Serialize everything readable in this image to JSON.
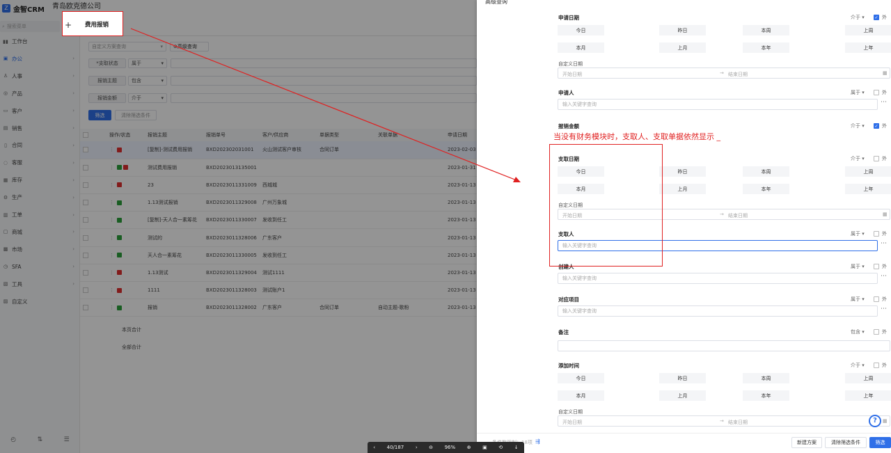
{
  "app": {
    "logo": "金智CRM",
    "company": "青岛欧克德公司"
  },
  "sidebar": {
    "search_placeholder": "搜索菜单",
    "items": [
      {
        "label": "工作台",
        "icon": "▮▮"
      },
      {
        "label": "办公",
        "icon": "▣"
      },
      {
        "label": "人事",
        "icon": "♙"
      },
      {
        "label": "产品",
        "icon": "◎"
      },
      {
        "label": "客户",
        "icon": "▭"
      },
      {
        "label": "销售",
        "icon": "▤"
      },
      {
        "label": "合同",
        "icon": "▯"
      },
      {
        "label": "客服",
        "icon": "◌"
      },
      {
        "label": "库存",
        "icon": "▦"
      },
      {
        "label": "生产",
        "icon": "⚙"
      },
      {
        "label": "工单",
        "icon": "▥"
      },
      {
        "label": "商城",
        "icon": "▢"
      },
      {
        "label": "市场",
        "icon": "▩"
      },
      {
        "label": "SFA",
        "icon": "◷"
      },
      {
        "label": "工具",
        "icon": "▧"
      },
      {
        "label": "自定义",
        "icon": "▨"
      }
    ],
    "bottom_icons": [
      "◴",
      "⇅",
      "☰"
    ]
  },
  "tab": {
    "plus": "+",
    "title": "费用报销"
  },
  "filters": {
    "scheme_placeholder": "自定义方案查询",
    "advanced_button": "高级查询",
    "rows": [
      {
        "field": "*支取状态",
        "op": "属于"
      },
      {
        "field": "报销主题",
        "op": "包含"
      },
      {
        "field": "报销金额",
        "op": "介于"
      }
    ],
    "filter_button": "筛选",
    "clear_button": "清除筛选条件"
  },
  "table": {
    "headers": [
      "操作/状态",
      "报销主题",
      "报销单号",
      "客户/供应商",
      "单据类型",
      "关联单据",
      "申请日期"
    ],
    "rows": [
      {
        "status": "r",
        "subject": "[复制]-测试费用报销",
        "no": "BXD202302031001",
        "customer": "火山测试客户审核",
        "type": "合同订单",
        "related": "",
        "date": "2023-02-03"
      },
      {
        "status": "gr",
        "subject": "测试费用报销",
        "no": "BXD2023013135001",
        "customer": "",
        "type": "",
        "related": "",
        "date": "2023-01-31"
      },
      {
        "status": "r",
        "subject": "23",
        "no": "BXD2023011331009",
        "customer": "西城城",
        "type": "",
        "related": "",
        "date": "2023-01-13"
      },
      {
        "status": "g",
        "subject": "1.13测试报销",
        "no": "BXD2023011329008",
        "customer": "广州万象城",
        "type": "",
        "related": "",
        "date": "2023-01-13"
      },
      {
        "status": "g",
        "subject": "[复制]-天人合一素筹花",
        "no": "BXD2023011330007",
        "customer": "发收到任工",
        "type": "",
        "related": "",
        "date": "2023-01-13"
      },
      {
        "status": "g",
        "subject": "测试的",
        "no": "BXD2023011328006",
        "customer": "广东客户",
        "type": "",
        "related": "",
        "date": "2023-01-13"
      },
      {
        "status": "g",
        "subject": "天人合一素筹花",
        "no": "BXD2023011330005",
        "customer": "发收到任工",
        "type": "",
        "related": "",
        "date": "2023-01-13"
      },
      {
        "status": "r",
        "subject": "1.13测试",
        "no": "BXD2023011329004",
        "customer": "测试1111",
        "type": "",
        "related": "",
        "date": "2023-01-13"
      },
      {
        "status": "r",
        "subject": "1111",
        "no": "BXD2023011328003",
        "customer": "测试账户1",
        "type": "",
        "related": "",
        "date": "2023-01-13"
      },
      {
        "status": "g",
        "subject": "报销",
        "no": "BXD2023011328002",
        "customer": "广东客户",
        "type": "合同订单",
        "related": "自动主题-歌粉",
        "date": "2023-01-13"
      }
    ],
    "page_total": "本页合计",
    "all_total": "全部合计"
  },
  "panel": {
    "title": "高级查询",
    "date_buttons": [
      "今日",
      "昨日",
      "本周",
      "上周",
      "本月",
      "上月",
      "本年",
      "上年"
    ],
    "custom_date": "自定义日期",
    "start_placeholder": "开始日期",
    "end_placeholder": "结束日期",
    "arrow": "→",
    "external": "外",
    "keyword_placeholder": "输入关键字查询",
    "sections": {
      "apply_date": {
        "label": "申请日期",
        "op": "介于"
      },
      "applicant": {
        "label": "申请人",
        "op": "属于"
      },
      "amount": {
        "label": "报销金额",
        "op": "介于"
      },
      "pay_date": {
        "label": "支取日期",
        "op": "介于"
      },
      "payer": {
        "label": "支取人",
        "op": "属于"
      },
      "creator": {
        "label": "创建人",
        "op": "属于"
      },
      "project": {
        "label": "对应项目",
        "op": "属于"
      },
      "remark": {
        "label": "备注",
        "op": "包含"
      },
      "add_time": {
        "label": "添加时间",
        "op": "介于"
      }
    },
    "footer": {
      "count": "条件数限制：18项",
      "new_scheme": "新建方案",
      "clear": "清除筛选条件",
      "filter": "筛选"
    }
  },
  "annotation": "当没有财务模块时，支取人、支取单据依然显示 _",
  "viewer": {
    "page": "40/187",
    "zoom": "96%"
  },
  "colors": {
    "accent": "#2f6fe8",
    "annotation": "#e02020"
  }
}
